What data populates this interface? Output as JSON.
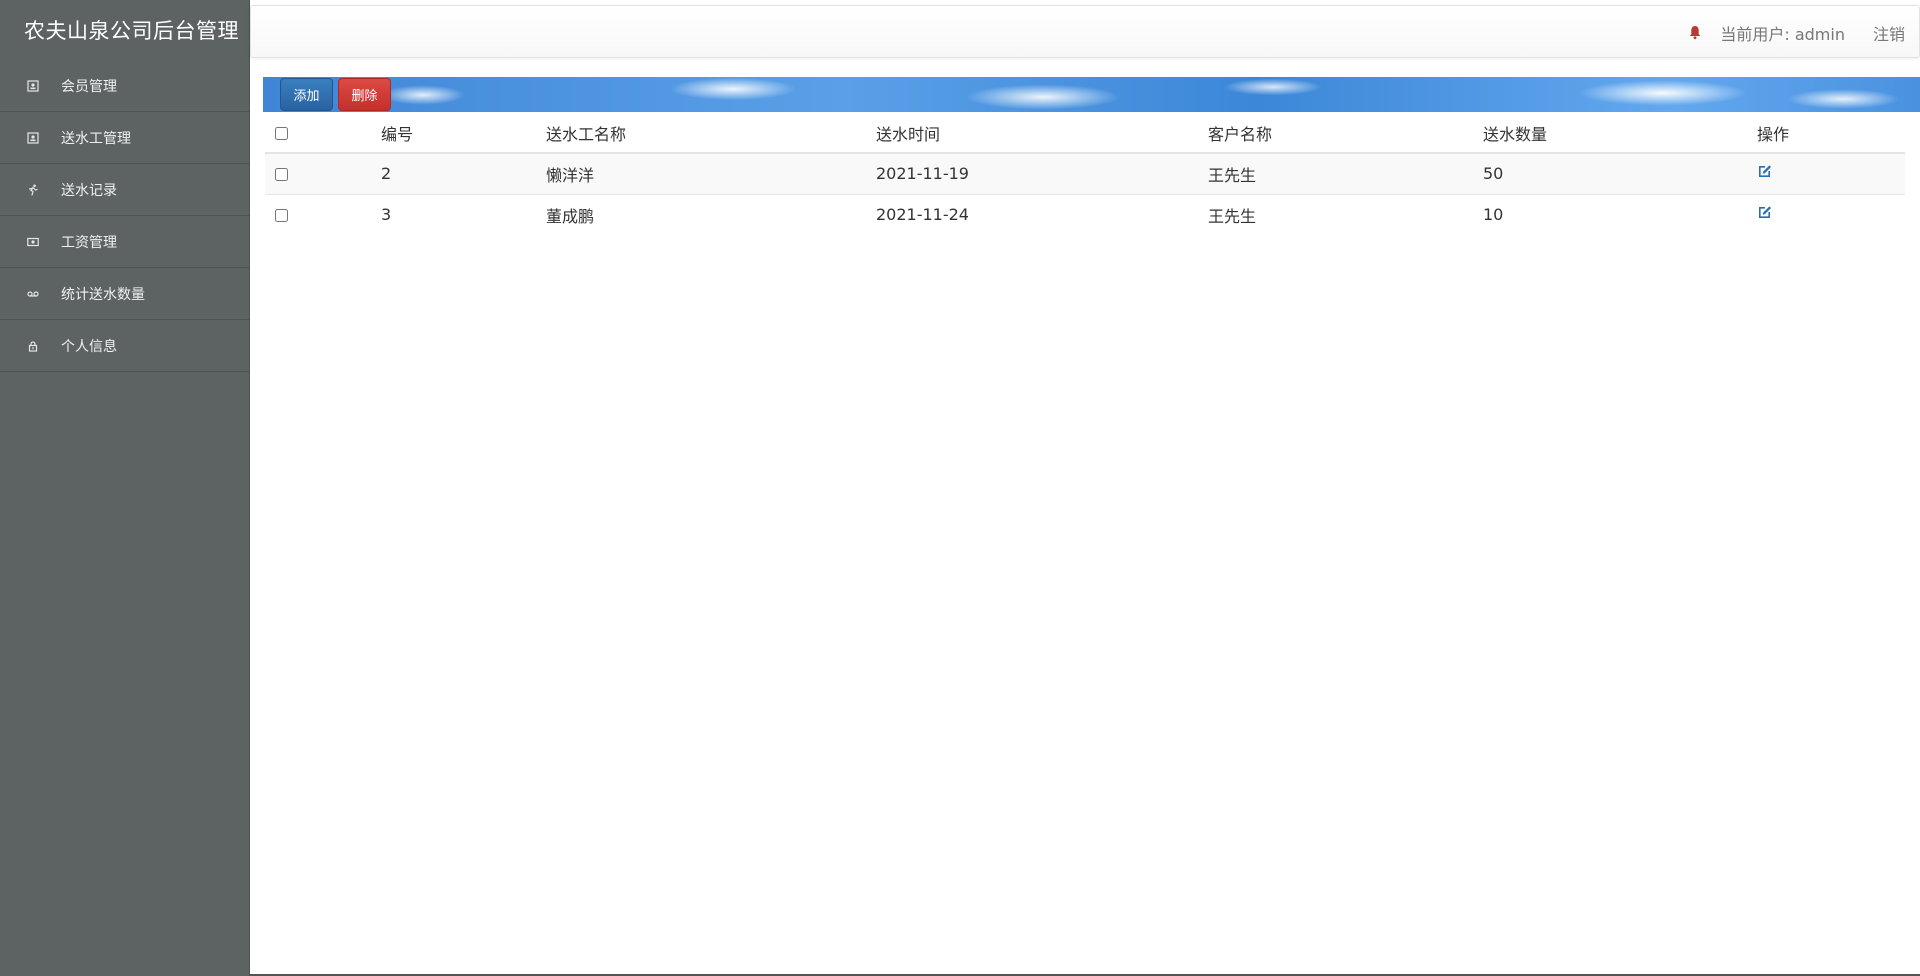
{
  "sidebar": {
    "brand": "农夫山泉公司后台管理",
    "items": [
      {
        "label": "会员管理",
        "icon": "user-card-icon"
      },
      {
        "label": "送水工管理",
        "icon": "user-card-icon"
      },
      {
        "label": "送水记录",
        "icon": "running-person-icon"
      },
      {
        "label": "工资管理",
        "icon": "money-icon"
      },
      {
        "label": "统计送水数量",
        "icon": "voicemail-icon"
      },
      {
        "label": "个人信息",
        "icon": "lock-icon"
      }
    ]
  },
  "topbar": {
    "current_user": "当前用户: admin",
    "logout": "注销"
  },
  "toolbar": {
    "add_label": "添加",
    "delete_label": "删除"
  },
  "table": {
    "headers": [
      "编号",
      "送水工名称",
      "送水时间",
      "客户名称",
      "送水数量",
      "操作"
    ],
    "rows": [
      {
        "id": "2",
        "worker": "懒洋洋",
        "time": "2021-11-19",
        "customer": "王先生",
        "quantity": "50"
      },
      {
        "id": "3",
        "worker": "董成鹏",
        "time": "2021-11-24",
        "customer": "王先生",
        "quantity": "10"
      }
    ]
  },
  "colors": {
    "sidebar_bg": "#5d6263",
    "add_button": "#2a62a0",
    "delete_button": "#c4302b",
    "bell": "#b83a38",
    "edit_icon": "#2a6db5"
  }
}
